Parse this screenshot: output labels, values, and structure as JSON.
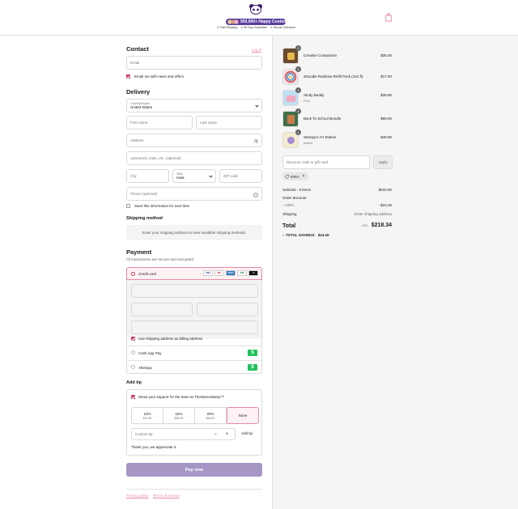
{
  "header": {
    "badge_text": "500,000+ Happy Customers",
    "perks": [
      "Fast Shipping",
      "60 Day Guarantee",
      "Secure Checkout"
    ]
  },
  "contact": {
    "title": "Contact",
    "login_link": "Log in",
    "email_placeholder": "Email",
    "news_label": "Email me with news and offers"
  },
  "delivery": {
    "title": "Delivery",
    "country_label": "Country/Region",
    "country_value": "United States",
    "first_name": "First name",
    "last_name": "Last name",
    "address": "Address",
    "apartment": "Apartment, suite, etc. (optional)",
    "city": "City",
    "state_label": "State",
    "state_value": "Iowa",
    "zip": "ZIP code",
    "phone": "Phone (optional)",
    "save_label": "Save this information for next time"
  },
  "shipping": {
    "title": "Shipping method",
    "notice": "Enter your shipping address to view available shipping methods."
  },
  "payment": {
    "title": "Payment",
    "subtitle": "All transactions are secure and encrypted.",
    "credit_card": "Credit card",
    "cards": [
      "VISA",
      "MC",
      "AMEX",
      "JCB",
      "+4"
    ],
    "billing_same": "Use shipping address as billing address",
    "cashapp": "Cash App Pay",
    "afterpay": "Afterpay"
  },
  "tip": {
    "title": "Add tip",
    "support_label": "Show your support for the team at TheNameStamp™",
    "options": [
      {
        "pct": "10%",
        "amt": "$21.83"
      },
      {
        "pct": "15%",
        "amt": "$35.09"
      },
      {
        "pct": "20%",
        "amt": "$43.67"
      }
    ],
    "none_label": "None",
    "custom_placeholder": "Custom tip",
    "add_label": "Add tip",
    "thanks": "Thank you, we appreciate it."
  },
  "pay_button": "Pay now",
  "footer": {
    "privacy": "Privacy policy",
    "terms": "Terms of service"
  },
  "summary": {
    "items": [
      {
        "name": "Creative Companion",
        "variant": "",
        "price": "$35.00",
        "qty": "1",
        "color": "#6b4a2e"
      },
      {
        "name": "3Doodle Rainbow Refill Pack (164 ft)",
        "variant": "",
        "price": "$17.90",
        "qty": "1",
        "color": "#e7c7de"
      },
      {
        "name": "Study Buddy",
        "variant": "Pink",
        "price": "$39.90",
        "qty": "1",
        "color": "#6aa6cf"
      },
      {
        "name": "Back To School Bundle",
        "variant": "",
        "price": "$99.90",
        "qty": "1",
        "color": "#3f6e4a"
      },
      {
        "name": "Stampy's Art Station",
        "variant": "yellow",
        "price": "$49.90",
        "qty": "1",
        "color": "#e8d06a"
      }
    ],
    "discount_placeholder": "Discount code or gift card",
    "apply_label": "Apply",
    "code_tag": "KIRA",
    "subtotal_label": "Subtotal · 5 items",
    "subtotal_value": "$242.60",
    "order_discount_label": "Order discount",
    "discount_code": "KIRA",
    "discount_value": "- $24.26",
    "shipping_label": "Shipping",
    "shipping_value": "Enter shipping address",
    "total_label": "Total",
    "currency": "USD",
    "total_value": "$218.34",
    "savings_label": "TOTAL SAVINGS",
    "savings_value": "$24.26"
  }
}
